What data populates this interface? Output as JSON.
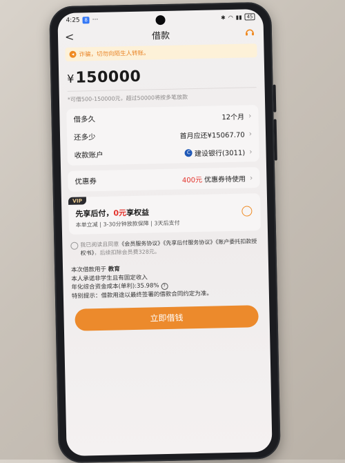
{
  "status_bar": {
    "time": "4:25",
    "battery": "45"
  },
  "nav": {
    "back": "<",
    "title": "借款"
  },
  "notice": {
    "text": "诈骗，切勿向陌生人转账。"
  },
  "amount": {
    "currency": "¥",
    "value": "150000",
    "hint": "*可借500-150000元，超过50000将按多笔放款"
  },
  "loan_rows": [
    {
      "label": "借多久",
      "value": "12个月"
    },
    {
      "label": "还多少",
      "value": "首月应还¥15067.70"
    },
    {
      "label": "收款账户",
      "value": "建设银行(3011)"
    }
  ],
  "coupon": {
    "label": "优惠券",
    "amount": "400元",
    "suffix": "优惠券待使用"
  },
  "vip": {
    "tag": "VIP",
    "title_prefix": "先享后付，",
    "title_highlight": "0元",
    "title_suffix": "享权益",
    "subtitle": "本单立减 | 3-30分钟放款保障 | 3天后支付"
  },
  "agreement": {
    "prefix": "我已阅读且同意",
    "docs": "《会员服务协议》《先享后付服务协议》《账户委托扣款授权书》",
    "suffix": "，后续扣除会员费328元。"
  },
  "info": {
    "purpose_label": "本次借款用于",
    "purpose_value": "教育",
    "line2": "本人承诺非学生且有固定收入",
    "rate_label": "年化综合资金成本(单利):",
    "rate_value": "35.98%",
    "line4": "特别提示：借款用途以最终签署的借款合同约定为准。"
  },
  "submit": {
    "label": "立即借钱"
  },
  "colors": {
    "accent": "#ec8a2c",
    "red": "#e3312a"
  }
}
